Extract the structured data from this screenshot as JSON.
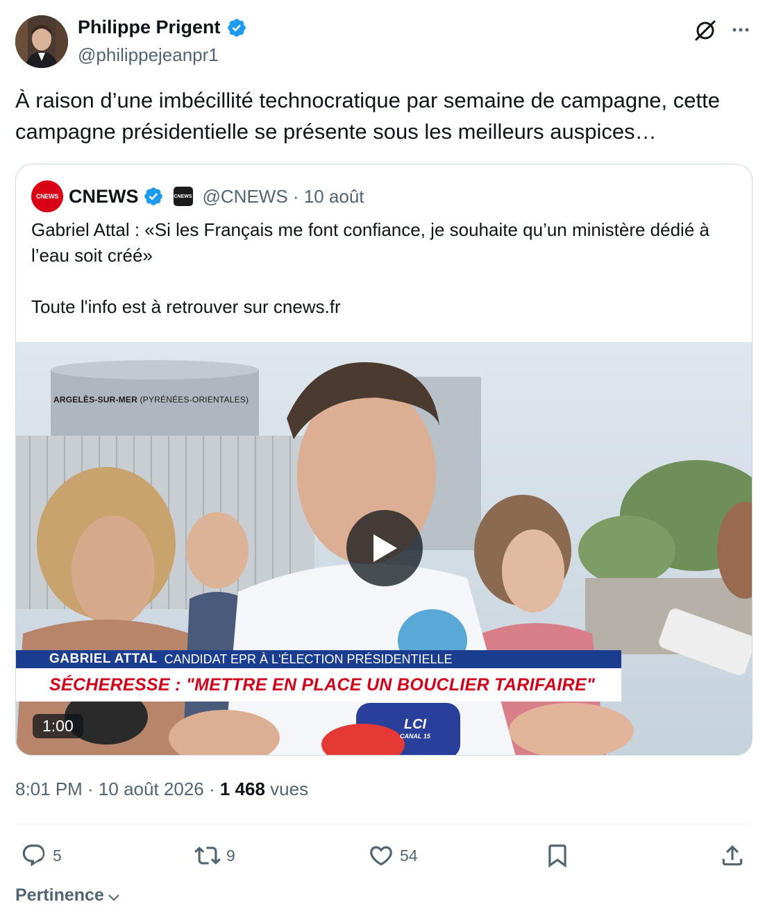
{
  "author": {
    "name": "Philippe Prigent",
    "handle": "@philippejeanpr1"
  },
  "tweet": {
    "text": "À raison d’une imbécillité technocratique par semaine de campagne, cette campagne présidentielle se présente sous les meilleurs auspices…"
  },
  "quote": {
    "avatar_text": "CNEWS",
    "name": "CNEWS",
    "affiliate_badge_text": "CNEWS",
    "handle_date": "@CNEWS · 10 août",
    "text": "Gabriel Attal : «Si les Français me font confiance, je souhaite qu’un ministère dédié à l’eau soit créé»\n\nToute l'info est à retrouver sur cnews.fr",
    "video": {
      "location": "ARGELÈS-SUR-MER",
      "location_sub": "(PYRÉNÉES-ORIENTALES)",
      "lower_third_name": "GABRIEL ATTAL",
      "lower_third_role": "CANDIDAT EPR À L'ÉLECTION PRÉSIDENTIELLE",
      "headline": "SÉCHERESSE : \"METTRE EN PLACE UN BOUCLIER TARIFAIRE\"",
      "mic_label": "LCI",
      "mic_sub": "CANAL 15",
      "duration": "1:00"
    }
  },
  "meta": {
    "time_date": "8:01 PM · 10 août 2026 · ",
    "views_count": "1 468",
    "views_label": " vues"
  },
  "actions": {
    "replies": "5",
    "reposts": "9",
    "likes": "54"
  },
  "sort": {
    "label": "Pertinence"
  },
  "colors": {
    "verified": "#1d9bf0",
    "text_primary": "#0f1419",
    "text_secondary": "#536471",
    "border": "#cfd9de",
    "cnews_red": "#d90016",
    "lower_third_blue": "#1a3d8f",
    "headline_red": "#d0021b"
  },
  "icons": {
    "verified": "verified-badge-icon",
    "grok": "grok-icon",
    "more": "more-icon",
    "play": "play-icon",
    "reply": "reply-icon",
    "repost": "repost-icon",
    "like": "heart-icon",
    "bookmark": "bookmark-icon",
    "share": "share-icon",
    "chevron": "chevron-down-icon"
  }
}
